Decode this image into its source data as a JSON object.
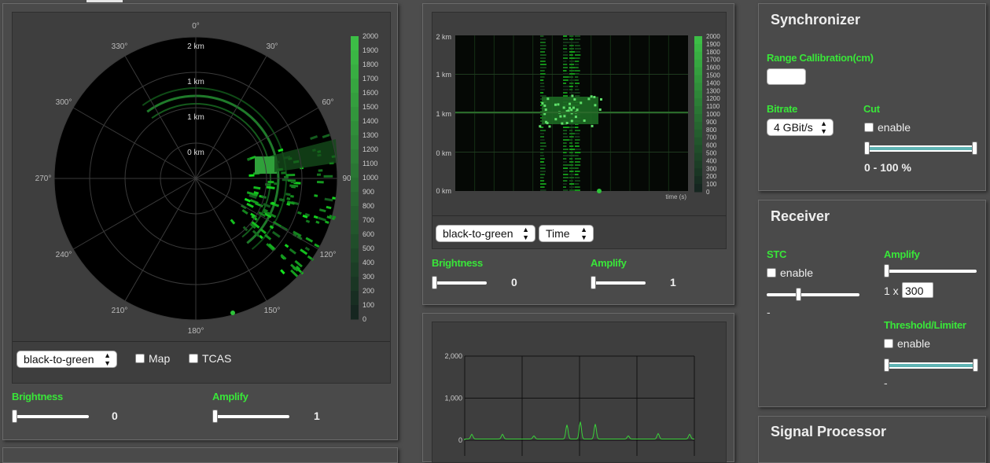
{
  "radar": {
    "angles": [
      "0°",
      "30°",
      "60°",
      "90°",
      "120°",
      "150°",
      "180°",
      "210°",
      "240°",
      "270°",
      "300°",
      "330°"
    ],
    "ranges": [
      "2 km",
      "1 km",
      "1 km",
      "0 km"
    ],
    "colorbar": [
      "2000",
      "1900",
      "1800",
      "1700",
      "1600",
      "1500",
      "1400",
      "1300",
      "1200",
      "1100",
      "1000",
      "900",
      "800",
      "700",
      "600",
      "500",
      "400",
      "300",
      "200",
      "100",
      "0"
    ],
    "colormap": "black-to-green",
    "map_label": "Map",
    "tcas_label": "TCAS",
    "brightness_label": "Brightness",
    "brightness_value": "0",
    "amplify_label": "Amplify",
    "amplify_value": "1"
  },
  "waterfall": {
    "ylabels": [
      "2 km",
      "1 km",
      "1 km",
      "0 km",
      "0 km"
    ],
    "xlabel": "time (s)",
    "colorbar": [
      "2000",
      "1900",
      "1800",
      "1700",
      "1600",
      "1500",
      "1400",
      "1300",
      "1200",
      "1100",
      "1000",
      "900",
      "800",
      "700",
      "600",
      "500",
      "400",
      "300",
      "200",
      "100",
      "0"
    ],
    "colormap": "black-to-green",
    "axis_mode": "Time",
    "brightness_label": "Brightness",
    "brightness_value": "0",
    "amplify_label": "Amplify",
    "amplify_value": "1"
  },
  "spectrum": {
    "yticks": [
      "2,000",
      "1,000",
      "0"
    ]
  },
  "synchronizer": {
    "title": "Synchronizer",
    "range_label": "Range Callibration(cm)",
    "range_value": "",
    "bitrate_label": "Bitrate",
    "bitrate_value": "4 GBit/s",
    "cut_label": "Cut",
    "cut_enable": "enable",
    "cut_range": "0 - 100 %"
  },
  "receiver": {
    "title": "Receiver",
    "stc_label": "STC",
    "stc_enable": "enable",
    "stc_value": "-",
    "amplify_label": "Amplify",
    "amplify_prefix": "1 x",
    "amplify_value": "300",
    "threshold_label": "Threshold/Limiter",
    "threshold_enable": "enable",
    "threshold_value": "-"
  },
  "signal_processor": {
    "title": "Signal Processor"
  },
  "colors": {
    "accent": "#39e639",
    "panel": "#4a4a4a",
    "plot_bg": "#000000",
    "slider_fill": "#5fb3b3"
  }
}
